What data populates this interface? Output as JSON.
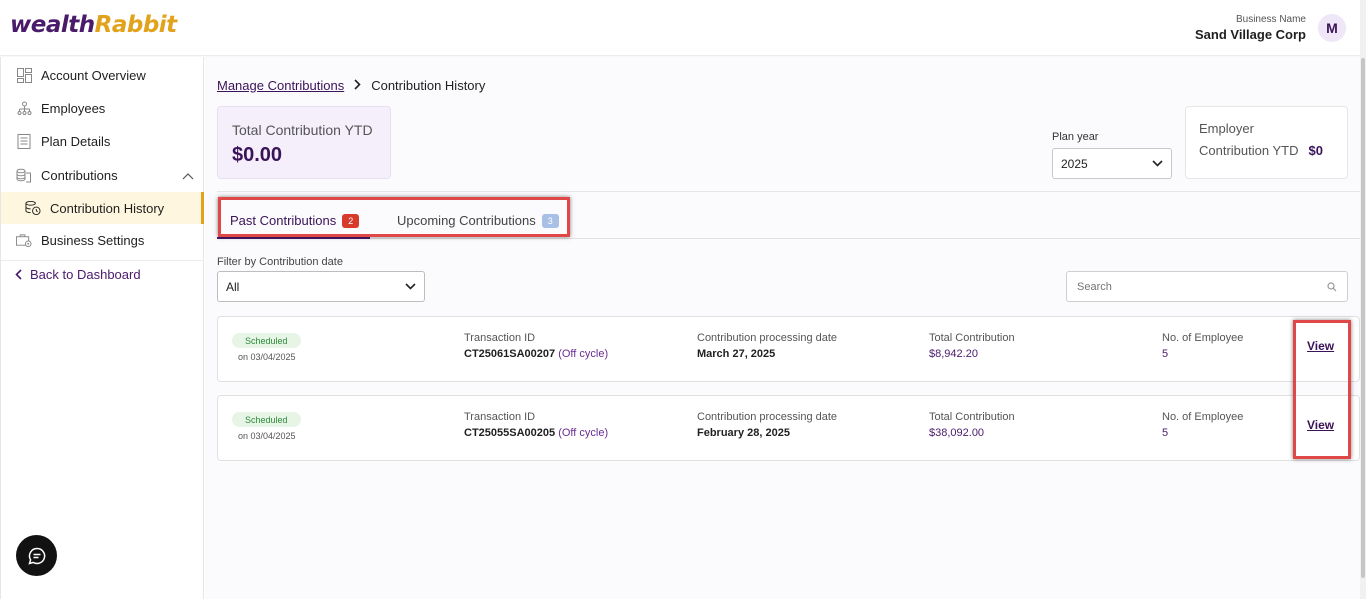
{
  "header": {
    "logo_text_1": "wealth",
    "logo_text_2": "Rabbit",
    "business_label": "Business Name",
    "business_name": "Sand Village Corp",
    "avatar_initial": "M"
  },
  "sidebar": {
    "items": [
      {
        "label": "Account Overview",
        "icon": "grid-icon"
      },
      {
        "label": "Employees",
        "icon": "org-chart-icon"
      },
      {
        "label": "Plan Details",
        "icon": "document-icon"
      },
      {
        "label": "Contributions",
        "icon": "coins-icon"
      },
      {
        "label": "Contribution History",
        "icon": "history-coins-icon"
      },
      {
        "label": "Business Settings",
        "icon": "briefcase-gear-icon"
      }
    ],
    "back_label": "Back to Dashboard"
  },
  "breadcrumb": {
    "parent": "Manage Contributions",
    "current": "Contribution History"
  },
  "ytd": {
    "label": "Total Contribution YTD",
    "value": "$0.00"
  },
  "plan_year": {
    "label": "Plan year",
    "value": "2025"
  },
  "employer": {
    "line1": "Employer",
    "line2": "Contribution YTD",
    "value": "$0"
  },
  "tabs": [
    {
      "label": "Past Contributions",
      "count": "2"
    },
    {
      "label": "Upcoming Contributions",
      "count": "3"
    }
  ],
  "filter": {
    "label": "Filter by Contribution date",
    "value": "All"
  },
  "search": {
    "placeholder": "Search"
  },
  "contributions": [
    {
      "status": "Scheduled",
      "date": "on 03/04/2025",
      "txn_label": "Transaction ID",
      "txn_id": "CT25061SA00207",
      "txn_tag": "(Off cycle)",
      "proc_label": "Contribution processing date",
      "proc_date": "March 27, 2025",
      "total_label": "Total Contribution",
      "total": "$8,942.20",
      "emp_label": "No. of Employee",
      "emp_count": "5",
      "action": "View"
    },
    {
      "status": "Scheduled",
      "date": "on 03/04/2025",
      "txn_label": "Transaction ID",
      "txn_id": "CT25055SA00205",
      "txn_tag": "(Off cycle)",
      "proc_label": "Contribution processing date",
      "proc_date": "February 28, 2025",
      "total_label": "Total Contribution",
      "total": "$38,092.00",
      "emp_label": "No. of Employee",
      "emp_count": "5",
      "action": "View"
    }
  ],
  "colors": {
    "brand_purple": "#3a1359",
    "brand_gold": "#e2a21c",
    "highlight_red": "#e04848"
  }
}
